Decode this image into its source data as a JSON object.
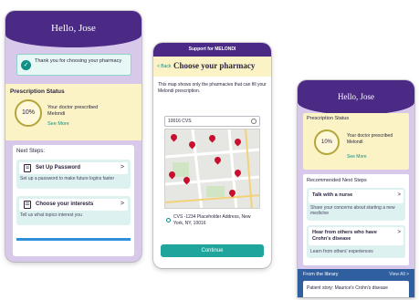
{
  "phone1": {
    "greeting": "Hello, Jose",
    "notice": "Thank you for choosing your pharmacy",
    "rx_title": "Prescription Status",
    "rx_progress": "10%",
    "rx_message_line1": "Your doctor prescribed",
    "rx_message_line2": "Melondi",
    "rx_see_more": "See More",
    "next_title": "Next Steps:",
    "card1_label": "Set Up Password",
    "card1_sub": "Set up a password to make future logins faster",
    "card2_label": "Choose your interests",
    "card2_sub": "Tell us what topics interest you",
    "chevron": ">"
  },
  "phone2": {
    "support_bar": "Support for MELONDI",
    "back": "< Back",
    "title": "Choose your pharmacy",
    "description": "This map shows only the pharmacies that can fill your Melondi prescription.",
    "search_value": "10016 CVS",
    "result": "CVS -1234 Placeholder Address, New York, NY, 10016",
    "continue": "Continue"
  },
  "phone3": {
    "greeting": "Hello, Jose",
    "rx_title": "Prescription Status",
    "rx_progress": "10%",
    "rx_message": "Your doctor prescribed Melondi",
    "rx_see_more": "See More",
    "rec_title": "Recommended Next Steps",
    "card1_label": "Talk with a nurse",
    "card1_sub": "Share your concerns about starting a new medicine",
    "card2_label_line1": "Hear from others who have",
    "card2_label_line2": "Crohn's disease",
    "card2_sub": "Learn from others' experiences",
    "chevron": ">",
    "library_title": "From the library",
    "view_all": "View All >",
    "story": "Patient story: Maurice's Crohn's disease"
  },
  "colors": {
    "brand_purple": "#4b2a86",
    "lavender": "#d8c8ea",
    "yellow_panel": "#fbf3c6",
    "teal": "#1fa59c",
    "map_pin_red": "#c8102e"
  },
  "icons": [
    "check-icon",
    "lock-icon",
    "list-icon",
    "chevron-right-icon",
    "search-icon",
    "map-pin-icon",
    "radio-selected-icon"
  ]
}
